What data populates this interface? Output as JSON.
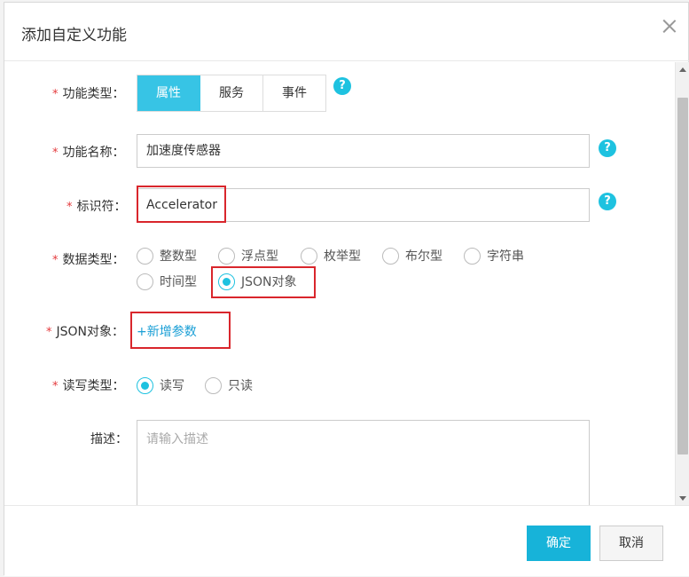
{
  "dialog": {
    "title": "添加自定义功能",
    "close_icon": "close-icon"
  },
  "form": {
    "required_mark": "*",
    "function_type": {
      "label": "功能类型：",
      "options": [
        "属性",
        "服务",
        "事件"
      ],
      "selected": "属性"
    },
    "function_name": {
      "label": "功能名称：",
      "value": "加速度传感器"
    },
    "identifier": {
      "label": "标识符：",
      "value": "Accelerator"
    },
    "data_type": {
      "label": "数据类型：",
      "options": [
        "整数型",
        "浮点型",
        "枚举型",
        "布尔型",
        "字符串",
        "时间型",
        "JSON对象"
      ],
      "selected": "JSON对象"
    },
    "json_object": {
      "label": "JSON对象：",
      "add_link": "+新增参数"
    },
    "rw_type": {
      "label": "读写类型：",
      "options": [
        "读写",
        "只读"
      ],
      "selected": "读写"
    },
    "description": {
      "label": "描述：",
      "placeholder": "请输入描述"
    },
    "help_glyph": "?"
  },
  "footer": {
    "confirm_label": "确定",
    "cancel_label": "取消"
  },
  "colors": {
    "accent": "#1ec2e0",
    "primary_button": "#17b3d9",
    "highlight": "#d9262c",
    "required": "#e4393c"
  }
}
